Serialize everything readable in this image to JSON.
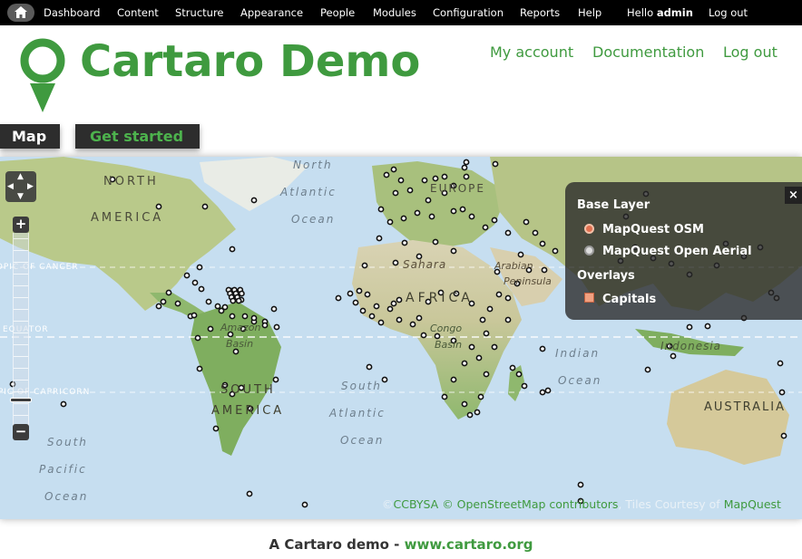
{
  "toolbar": {
    "items": [
      "Dashboard",
      "Content",
      "Structure",
      "Appearance",
      "People",
      "Modules",
      "Configuration",
      "Reports",
      "Help"
    ],
    "hello": "Hello",
    "user": "admin",
    "logout": "Log out",
    "home_icon": "home-icon"
  },
  "header": {
    "site_name": "Cartaro Demo",
    "logo_icon": "map-pin-icon",
    "secondary_menu": [
      "My account",
      "Documentation",
      "Log out"
    ]
  },
  "tabs": [
    "Map",
    "Get started"
  ],
  "map": {
    "labels": {
      "north_america": [
        "NORTH",
        "AMERICA"
      ],
      "south_america": [
        "SOUTH",
        "AMERICA"
      ],
      "europe": "EUROPE",
      "africa": "AFRICA",
      "asia_sahara": "Sahara",
      "arabian": [
        "Arabian",
        "Peninsula"
      ],
      "amazon": [
        "Amazon",
        "Basin"
      ],
      "congo": [
        "Congo",
        "Basin"
      ],
      "indonesia": "Indonesia",
      "australia": "AUSTRALIA",
      "north_atlantic": [
        "North",
        "Atlantic",
        "Ocean"
      ],
      "south_atlantic": [
        "South",
        "Atlantic",
        "Ocean"
      ],
      "south_pacific": [
        "South",
        "Pacific",
        "Ocean"
      ],
      "indian": [
        "Indian",
        "Ocean"
      ],
      "tropic_cancer": "TROPIC OF CANCER",
      "equator": "EQUATOR",
      "tropic_capricorn": "TROPIC OF CAPRICORN"
    },
    "layer_switcher": {
      "base_title": "Base Layer",
      "base_layers": [
        {
          "label": "MapQuest OSM",
          "selected": true
        },
        {
          "label": "MapQuest Open Aerial",
          "selected": false
        }
      ],
      "overlays_title": "Overlays",
      "overlays": [
        {
          "label": "Capitals",
          "checked": true
        }
      ],
      "close_label": "×"
    },
    "zoom": {
      "in": "+",
      "out": "−",
      "level_fraction": 0.82
    },
    "attribution": {
      "copy": "©",
      "license": "CCBYSA",
      "osm": "© OpenStreetMap contributors",
      "tiles": "Tiles Courtesy of",
      "mapquest": "MapQuest"
    }
  },
  "footer": {
    "text": "A Cartaro demo -",
    "link": "www.cartaro.org"
  },
  "colors": {
    "brand_green": "#3f9a3f",
    "toolbar_bg": "#000000",
    "ocean": "#c6def0"
  }
}
